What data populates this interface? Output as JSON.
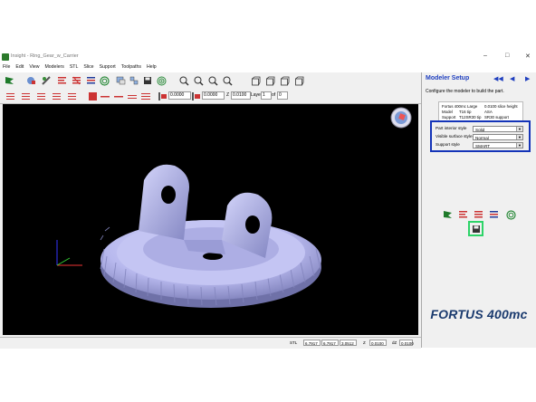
{
  "window": {
    "title": "Insight - Ring_Gear_w_Carrier"
  },
  "menu": [
    "File",
    "Edit",
    "View",
    "Modelers",
    "STL",
    "Slice",
    "Support",
    "Toolpaths",
    "Help"
  ],
  "toolbar2": {
    "field1": "0.0000",
    "field2": "0.0000",
    "z_label": "Z",
    "z_value": "0.0100",
    "layer_label": "Layer",
    "layer_value": "1",
    "of_label": "of",
    "of_value": "0"
  },
  "panel": {
    "title": "Modeler Setup",
    "description": "Configure the modeler to build the part.",
    "info": {
      "machine": "Fortus 400mc Large",
      "slice": "0.0100 slice height",
      "model_label": "Model",
      "model_tip": "T16 tip",
      "model_mat": "ASA",
      "support_label": "Support",
      "support_tip": "T12SR30 tip",
      "support_mat": "SR30 support"
    },
    "fields": [
      {
        "label": "Part interior style",
        "value": "Solid"
      },
      {
        "label": "Visible surface style",
        "value": "Normal"
      },
      {
        "label": "Support style",
        "value": "SMART"
      }
    ],
    "logo": "FORTUS 400mc"
  },
  "status": {
    "stl": "STL",
    "x": "6.7917",
    "y": "6.7917",
    "z": "3.0512",
    "z_label": "Z",
    "z_value": "0.0100",
    "dz_label": "dZ",
    "dz_value": "0.0100"
  },
  "colors": {
    "accent": "#1434b8",
    "highlight": "#2dd468",
    "viewport": "#000000",
    "part": "#b8b9ee",
    "logo": "#1a3a6e"
  }
}
